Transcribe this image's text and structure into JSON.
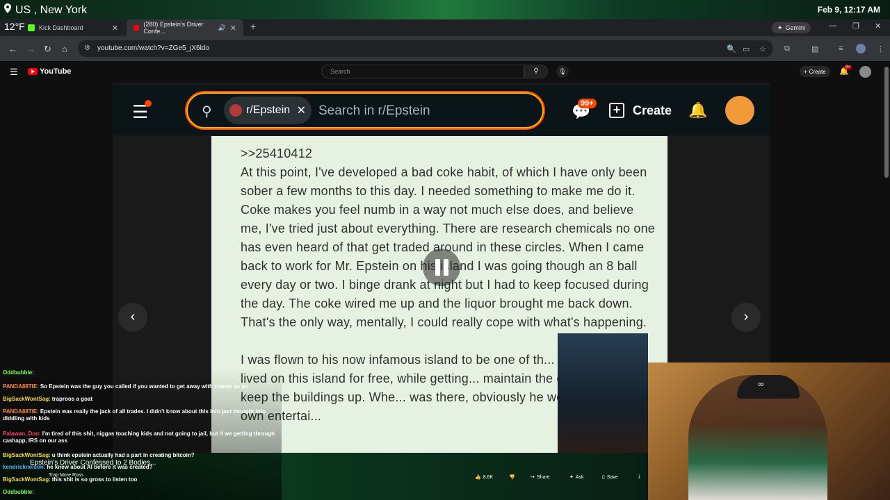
{
  "overlay": {
    "location": "US , New York",
    "weather": "12°F",
    "datetime": "Feb 9, 12:17 AM"
  },
  "browser": {
    "tabs": [
      {
        "label": "Kick Dashboard",
        "active": false
      },
      {
        "label": "(280) Epstein's Driver Confe...",
        "active": true
      }
    ],
    "gemini_label": "Gemini",
    "url": "youtube.com/watch?v=ZGe5_jX6ldo"
  },
  "youtube": {
    "logo": "YouTube",
    "search_placeholder": "Search",
    "create_label": "Create",
    "notif_count": "9+",
    "video_title": "Epstein's Driver Confessed to 2 Bodies...",
    "channel": "Trap More Ross",
    "actions": {
      "likes": "8.6K",
      "share": "Share",
      "ask": "Ask",
      "save": "Save"
    }
  },
  "reddit": {
    "community_chip": "r/Epstein",
    "search_placeholder": "Search in r/Epstein",
    "chat_badge": "99+",
    "create_label": "Create"
  },
  "post": {
    "ref_id": ">>25410412",
    "paragraph1": "At this point, I've developed a bad coke habit, of which I have only been sober a few months to this day. I needed something to make me do it. Coke makes you feel numb in a way not much else does, and believe me, I've tried just about everything. There are research chemicals no one has even heard of that get traded around in these circles. When I came back to work for Mr. Epstein on his island I was going though an 8 ball every day or two. I binge drank at night but I had to keep focused during the day. The coke wired me up and the liquor brought me back down. That's the only way, mentally, I could really cope with what's happening.",
    "paragraph2": "I was flown to his now infamous island to be one of th... Essentially I lived on this island for free, while getting... maintain the grounds and keep the buildings up. Whe... was there, obviously he would bring his own entertai..."
  },
  "chat": [
    {
      "user": "Oddbubble:",
      "msg": "",
      "color": "#7cff5a"
    },
    {
      "user": "PANDA88TIE:",
      "msg": "So Epstein was the guy you called if you wanted to get away with crimes as an",
      "color": "#ff8a3a"
    },
    {
      "user": "BigSackWontSag:",
      "msg": "traproos a goat",
      "color": "#ffd84a"
    },
    {
      "user": "PANDA88TIE:",
      "msg": "Epstein was really the jack of all trades. I didn't know about this info just thought into diddling with kids",
      "color": "#ff8a3a"
    },
    {
      "user": "Palawan_Don:",
      "msg": "I'm tired of this shit, niggas touching kids and not going to jail, but if we getting through cashapp, IRS on our ass",
      "color": "#ff4a6a"
    },
    {
      "user": "BigSackWontSag:",
      "msg": "u think epstein actually had a part in creating bitcoin?",
      "color": "#ffd84a"
    },
    {
      "user": "kendricknelson:",
      "msg": "he knew about AI before it was created?",
      "color": "#5ab4ff"
    },
    {
      "user": "BigSackWontSag:",
      "msg": "this shit is so gross to listen too",
      "color": "#ffd84a"
    },
    {
      "user": "Oddbubble:",
      "msg": "",
      "color": "#7cff5a"
    }
  ]
}
